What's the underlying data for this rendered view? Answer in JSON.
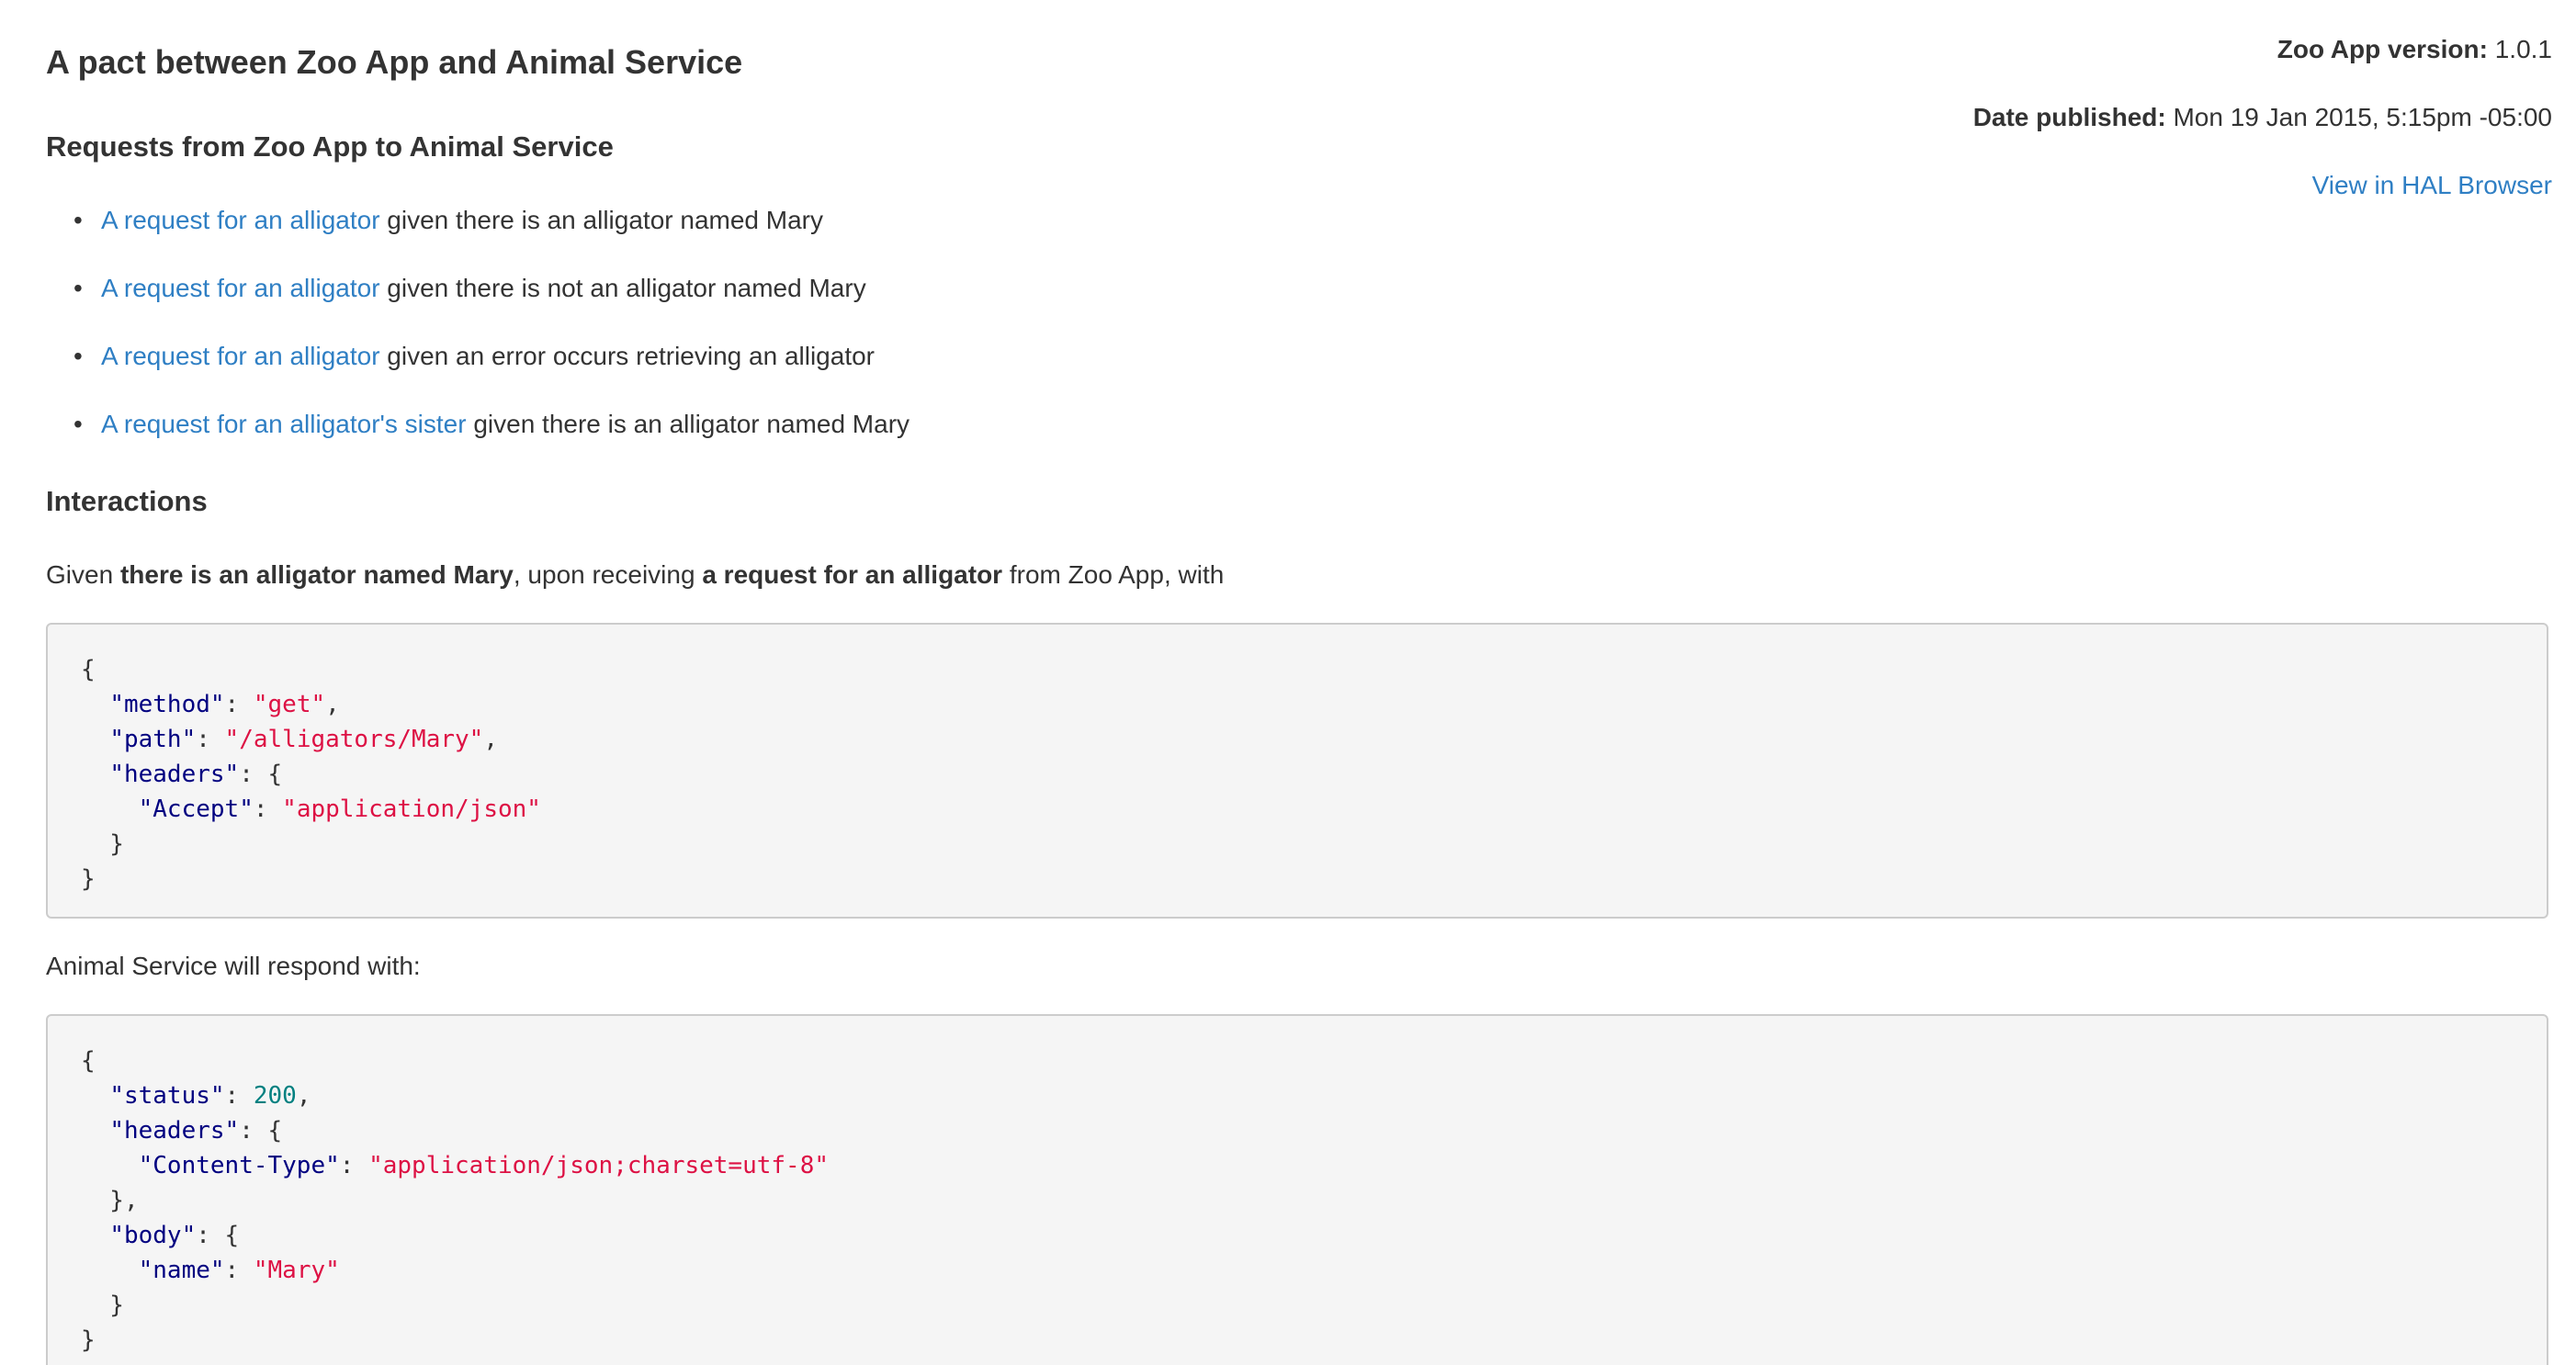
{
  "meta": {
    "version_label": "Zoo App version:",
    "version_value": "1.0.1",
    "published_label": "Date published:",
    "published_value": "Mon 19 Jan 2015, 5:15pm -05:00",
    "hal_link": "View in HAL Browser"
  },
  "title": "A pact between Zoo App and Animal Service",
  "requests_heading": "Requests from Zoo App to Animal Service",
  "requests": [
    {
      "link": "A request for an alligator",
      "rest": "given there is an alligator named Mary"
    },
    {
      "link": "A request for an alligator",
      "rest": "given there is not an alligator named Mary"
    },
    {
      "link": "A request for an alligator",
      "rest": "given an error occurs retrieving an alligator"
    },
    {
      "link": "A request for an alligator's sister",
      "rest": "given there is an alligator named Mary"
    }
  ],
  "interactions_heading": "Interactions",
  "interaction": {
    "given_prefix": "Given",
    "given_state": "there is an alligator named Mary",
    "upon_receiving": ", upon receiving",
    "request_desc": "a request for an alligator",
    "from_text": "from Zoo App, with",
    "respond_text": "Animal Service will respond with:"
  },
  "request_json": {
    "method_key": "\"method\"",
    "method_val": "\"get\"",
    "path_key": "\"path\"",
    "path_val": "\"/alligators/Mary\"",
    "headers_key": "\"headers\"",
    "accept_key": "\"Accept\"",
    "accept_val": "\"application/json\""
  },
  "response_json": {
    "status_key": "\"status\"",
    "status_val": "200",
    "headers_key": "\"headers\"",
    "content_type_key": "\"Content-Type\"",
    "content_type_val": "\"application/json;charset=utf-8\"",
    "body_key": "\"body\"",
    "name_key": "\"name\"",
    "name_val": "\"Mary\""
  },
  "colors": {
    "link": "#2f7fc4",
    "json_key": "#000080",
    "json_string": "#dd1144",
    "json_number": "#008080"
  }
}
